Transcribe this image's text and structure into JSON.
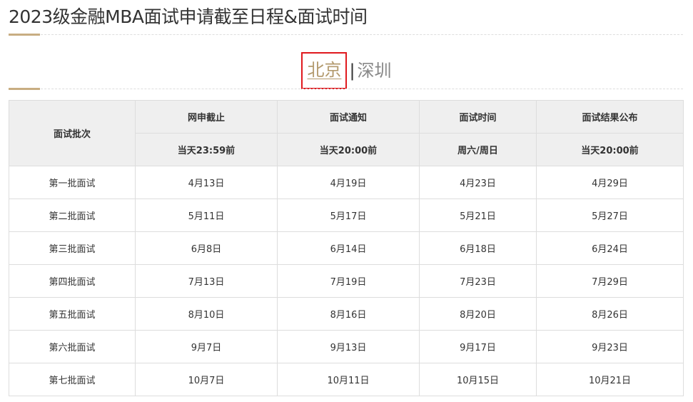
{
  "page": {
    "title": "2023级金融MBA面试申请截至日程&面试时间"
  },
  "city_tabs": {
    "active": "北京",
    "separator": "|",
    "other": "深圳"
  },
  "table": {
    "batch_header": "面试批次",
    "columns": [
      {
        "name": "网申截止",
        "sub": "当天23:59前"
      },
      {
        "name": "面试通知",
        "sub": "当天20:00前"
      },
      {
        "name": "面试时间",
        "sub": "周六/周日"
      },
      {
        "name": "面试结果公布",
        "sub": "当天20:00前"
      }
    ],
    "rows": [
      [
        "第一批面试",
        "4月13日",
        "4月19日",
        "4月23日",
        "4月29日"
      ],
      [
        "第二批面试",
        "5月11日",
        "5月17日",
        "5月21日",
        "5月27日"
      ],
      [
        "第三批面试",
        "6月8日",
        "6月14日",
        "6月18日",
        "6月24日"
      ],
      [
        "第四批面试",
        "7月13日",
        "7月19日",
        "7月23日",
        "7月29日"
      ],
      [
        "第五批面试",
        "8月10日",
        "8月16日",
        "8月20日",
        "8月26日"
      ],
      [
        "第六批面试",
        "9月7日",
        "9月13日",
        "9月17日",
        "9月23日"
      ],
      [
        "第七批面试",
        "10月7日",
        "10月11日",
        "10月15日",
        "10月21日"
      ]
    ]
  },
  "colors": {
    "accent": "#c8ad82",
    "active_tab": "#b39a6e",
    "highlight_box": "#e0191e",
    "header_bg": "#efefef"
  }
}
